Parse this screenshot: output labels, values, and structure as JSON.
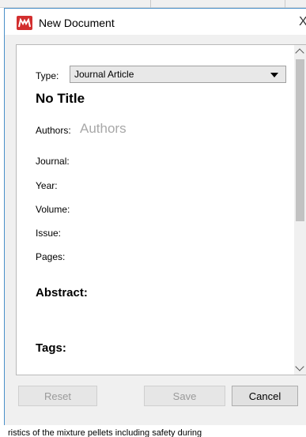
{
  "window": {
    "title": "New Document",
    "close_glyph": "X",
    "icon": "mendeley-logo-icon",
    "accent": "#d32f2f",
    "border_color": "#4a90c9"
  },
  "form": {
    "type_label": "Type:",
    "type_value": "Journal Article",
    "doc_title": "No Title",
    "authors_label": "Authors:",
    "authors_placeholder": "Authors",
    "fields": [
      "Journal:",
      "Year:",
      "Volume:",
      "Issue:",
      "Pages:"
    ],
    "abstract_label": "Abstract:",
    "tags_label": "Tags:"
  },
  "buttons": {
    "reset": "Reset",
    "save": "Save",
    "cancel": "Cancel"
  },
  "background_text": "ristics of the mixture pellets including safety during"
}
